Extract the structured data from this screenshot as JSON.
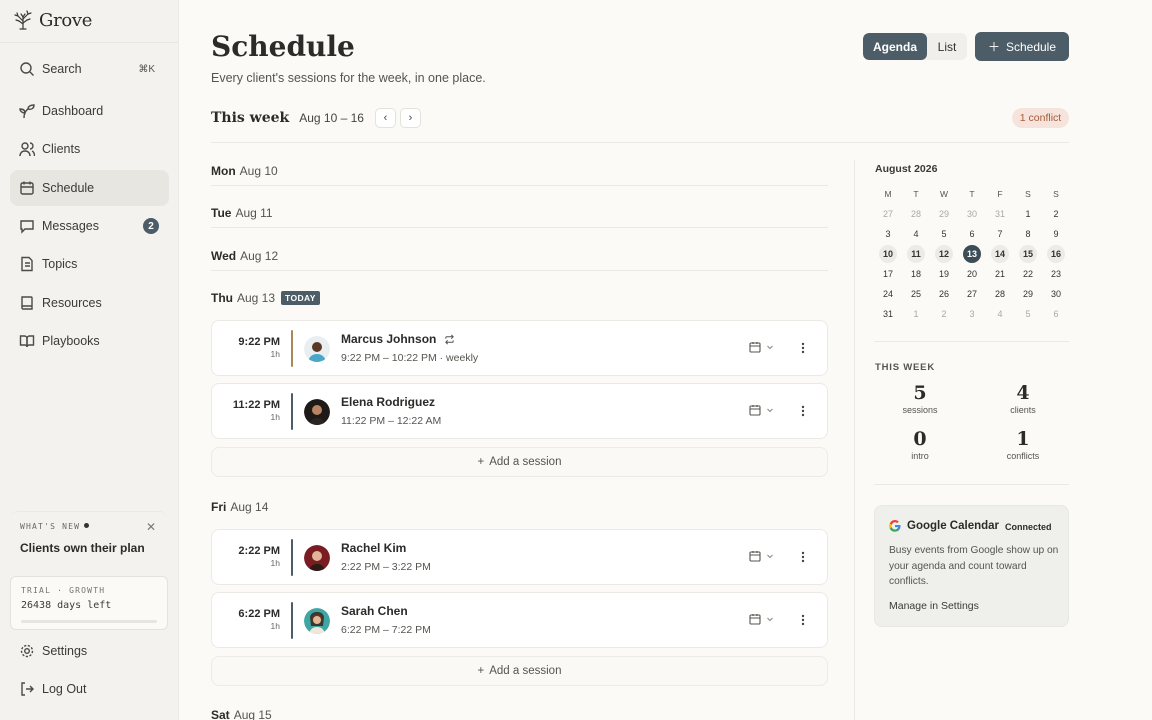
{
  "app": {
    "name": "Grove"
  },
  "sidebar": {
    "search_label": "Search",
    "search_shortcut": "⌘K",
    "items": [
      {
        "label": "Dashboard"
      },
      {
        "label": "Clients"
      },
      {
        "label": "Schedule"
      },
      {
        "label": "Messages",
        "badge": "2"
      },
      {
        "label": "Topics"
      },
      {
        "label": "Resources"
      },
      {
        "label": "Playbooks"
      }
    ],
    "whats_new": {
      "kicker": "WHAT'S NEW",
      "title": "Clients own their plan"
    },
    "trial": {
      "kicker": "TRIAL · GROWTH",
      "days_left": "26438 days left"
    },
    "settings_label": "Settings",
    "logout_label": "Log Out"
  },
  "header": {
    "title": "Schedule",
    "subtitle": "Every client's sessions for the week, in one place.",
    "view_agenda": "Agenda",
    "view_list": "List",
    "schedule_button": "Schedule"
  },
  "week": {
    "label": "This week",
    "range": "Aug 10 – 16",
    "conflict_badge": "1 conflict"
  },
  "days": [
    {
      "day": "Mon",
      "date": "Aug 10"
    },
    {
      "day": "Tue",
      "date": "Aug 11"
    },
    {
      "day": "Wed",
      "date": "Aug 12"
    },
    {
      "day": "Thu",
      "date": "Aug 13",
      "tag": "TODAY"
    },
    {
      "day": "Fri",
      "date": "Aug 14"
    },
    {
      "day": "Sat",
      "date": "Aug 15"
    }
  ],
  "sessions": [
    {
      "time": "9:22 PM",
      "duration": "1h",
      "name": "Marcus Johnson",
      "detail": "9:22 PM – 10:22 PM · weekly",
      "bar_color": "#a88a5a"
    },
    {
      "time": "11:22 PM",
      "duration": "1h",
      "name": "Elena Rodriguez",
      "detail": "11:22 PM – 12:22 AM",
      "bar_color": "#4c5d67"
    },
    {
      "time": "2:22 PM",
      "duration": "1h",
      "name": "Rachel Kim",
      "detail": "2:22 PM – 3:22 PM",
      "bar_color": "#4c5d67"
    },
    {
      "time": "6:22 PM",
      "duration": "1h",
      "name": "Sarah Chen",
      "detail": "6:22 PM – 7:22 PM",
      "bar_color": "#4c5d67"
    }
  ],
  "add_session_label": "Add a session",
  "calendar": {
    "month": "August 2026",
    "weekdays": [
      "M",
      "T",
      "W",
      "T",
      "F",
      "S",
      "S"
    ],
    "weeks": [
      [
        "27",
        "28",
        "29",
        "30",
        "31",
        "1",
        "2"
      ],
      [
        "3",
        "4",
        "5",
        "6",
        "7",
        "8",
        "9"
      ],
      [
        "10",
        "11",
        "12",
        "13",
        "14",
        "15",
        "16"
      ],
      [
        "17",
        "18",
        "19",
        "20",
        "21",
        "22",
        "23"
      ],
      [
        "24",
        "25",
        "26",
        "27",
        "28",
        "29",
        "30"
      ],
      [
        "31",
        "1",
        "2",
        "3",
        "4",
        "5",
        "6"
      ]
    ],
    "selected": "13"
  },
  "this_week": {
    "label": "THIS WEEK",
    "stats": [
      {
        "value": "5",
        "label": "sessions"
      },
      {
        "value": "4",
        "label": "clients"
      },
      {
        "value": "0",
        "label": "intro"
      },
      {
        "value": "1",
        "label": "conflicts"
      }
    ]
  },
  "gcal": {
    "title": "Google Calendar",
    "status": "Connected",
    "body": "Busy events from Google show up on your agenda and count toward conflicts.",
    "link": "Manage in Settings"
  },
  "colors": {
    "accent": "#4c5d67",
    "conflict_bg": "#f6e4dc",
    "conflict_text": "#a55a3a"
  }
}
